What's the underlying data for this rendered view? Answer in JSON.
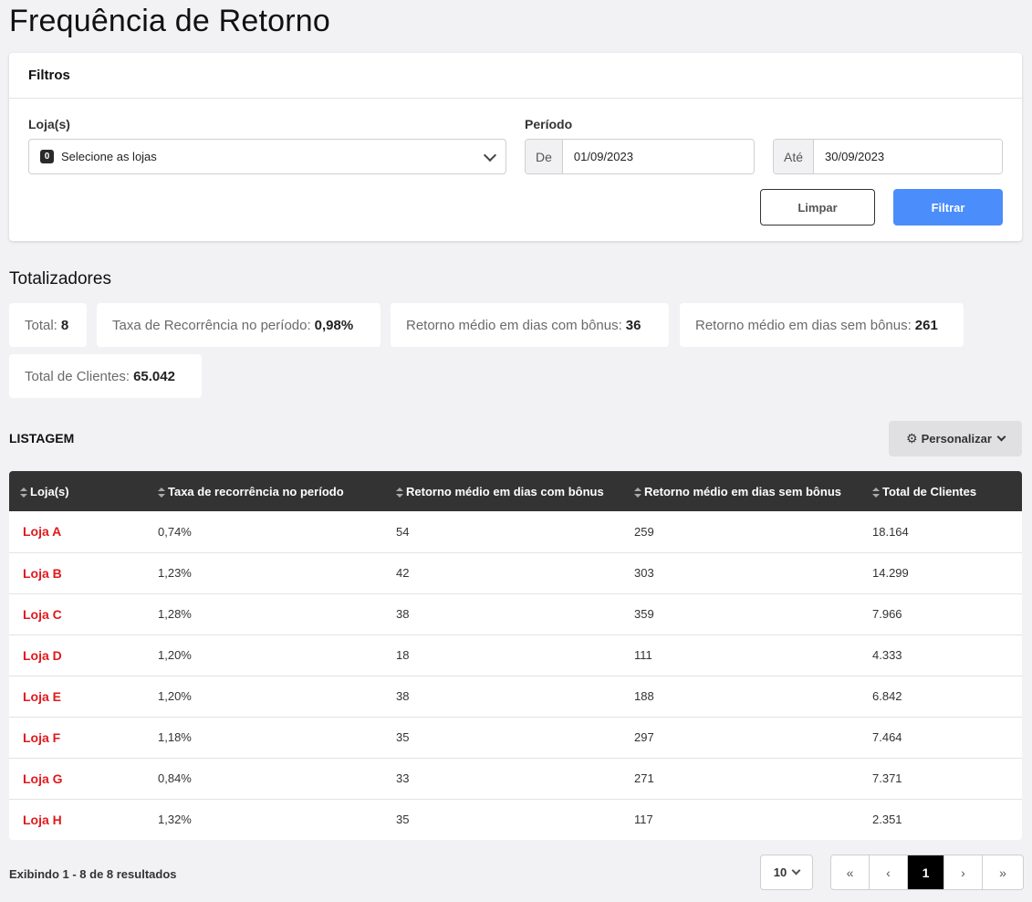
{
  "page": {
    "title": "Frequência de Retorno"
  },
  "filters": {
    "title": "Filtros",
    "stores_label": "Loja(s)",
    "stores_count": "0",
    "stores_placeholder": "Selecione as lojas",
    "period_label": "Período",
    "from_addon": "De",
    "from_value": "01/09/2023",
    "to_addon": "Até",
    "to_value": "30/09/2023",
    "clear_label": "Limpar",
    "filter_label": "Filtrar"
  },
  "totals": {
    "title": "Totalizadores",
    "items": [
      {
        "label": "Total:",
        "value": "8"
      },
      {
        "label": "Taxa de Recorrência no período:",
        "value": "0,98%"
      },
      {
        "label": "Retorno médio em dias com bônus:",
        "value": "36"
      },
      {
        "label": "Retorno médio em dias sem bônus:",
        "value": "261"
      },
      {
        "label": "Total de Clientes:",
        "value": "65.042"
      }
    ]
  },
  "listing": {
    "title": "LISTAGEM",
    "customize_label": "Personalizar",
    "columns": [
      "Loja(s)",
      "Taxa de recorrência no período",
      "Retorno médio em dias com bônus",
      "Retorno médio em dias sem bônus",
      "Total de Clientes"
    ],
    "rows": [
      [
        "Loja A",
        "0,74%",
        "54",
        "259",
        "18.164"
      ],
      [
        "Loja B",
        "1,23%",
        "42",
        "303",
        "14.299"
      ],
      [
        "Loja C",
        "1,28%",
        "38",
        "359",
        "7.966"
      ],
      [
        "Loja D",
        "1,20%",
        "18",
        "111",
        "4.333"
      ],
      [
        "Loja E",
        "1,20%",
        "38",
        "188",
        "6.842"
      ],
      [
        "Loja F",
        "1,18%",
        "35",
        "297",
        "7.464"
      ],
      [
        "Loja G",
        "0,84%",
        "33",
        "271",
        "7.371"
      ],
      [
        "Loja H",
        "1,32%",
        "35",
        "117",
        "2.351"
      ]
    ]
  },
  "footer": {
    "results_text": "Exibindo 1 - 8 de 8 resultados",
    "page_size": "10",
    "first": "«",
    "prev": "‹",
    "current_page": "1",
    "next": "›",
    "last": "»"
  },
  "colors": {
    "accent": "#4a8dfb",
    "store_link": "#e0191d",
    "table_header": "#333333"
  }
}
